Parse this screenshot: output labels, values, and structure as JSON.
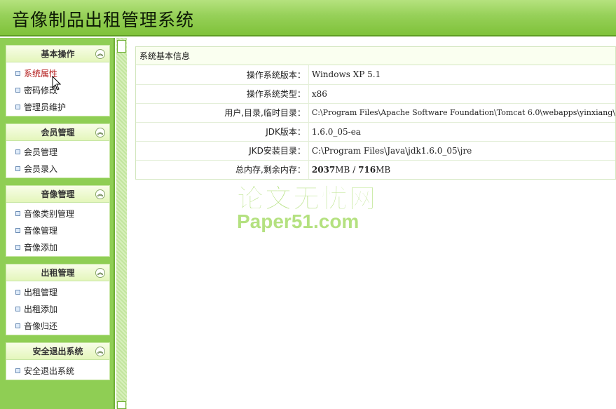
{
  "app": {
    "title": "音像制品出租管理系统"
  },
  "menu": [
    {
      "title": "基本操作",
      "items": [
        "系统属性",
        "密码修改",
        "管理员维护"
      ],
      "active_index": 0
    },
    {
      "title": "会员管理",
      "items": [
        "会员管理",
        "会员录入"
      ]
    },
    {
      "title": "音像管理",
      "items": [
        "音像类别管理",
        "音像管理",
        "音像添加"
      ]
    },
    {
      "title": "出租管理",
      "items": [
        "出租管理",
        "出租添加",
        "音像归还"
      ]
    },
    {
      "title": "安全退出系统",
      "items": [
        "安全退出系统"
      ]
    }
  ],
  "info": {
    "title": "系统基本信息",
    "rows": [
      {
        "label": "操作系统版本：",
        "value": "Windows XP  5.1"
      },
      {
        "label": "操作系统类型：",
        "value": "x86"
      },
      {
        "label": "用户,目录,临时目录：",
        "value": "C:\\Program Files\\Apache Software Foundation\\Tomcat 6.0\\webapps\\yinxiang\\"
      },
      {
        "label": "JDK版本：",
        "value": "1.6.0_05-ea"
      },
      {
        "label": "JKD安装目录：",
        "value": "C:\\Program Files\\Java\\jdk1.6.0_05\\jre"
      }
    ],
    "memory": {
      "label": "总内存,剩余内存：",
      "total": "2037",
      "total_unit": "MB",
      "separator": "/",
      "free": "716",
      "free_unit": "MB"
    }
  },
  "watermark": {
    "line1": "论文无忧网",
    "line2": "Paper51.com"
  },
  "icons": {
    "collapse": "double-chevron-up-icon",
    "bullet": "square-bullet-icon",
    "cursor": "mouse-pointer-icon"
  },
  "colors": {
    "header": "#96d058",
    "sidebar": "#8fce54",
    "active_link": "#b01313",
    "group_header": "#e4f6bb"
  }
}
